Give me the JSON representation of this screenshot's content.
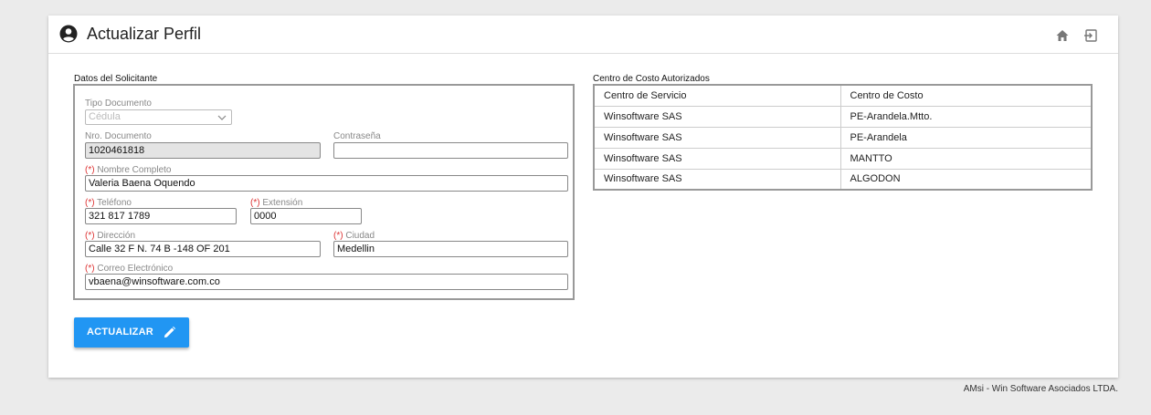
{
  "header": {
    "title": "Actualizar Perfil",
    "title_icon": "user-circle-icon",
    "home_icon": "home-icon",
    "exit_icon": "exit-icon"
  },
  "form": {
    "section_label": "Datos del Solicitante",
    "tipo_documento": {
      "label": "Tipo Documento",
      "value": "Cédula"
    },
    "nro_documento": {
      "label": "Nro. Documento",
      "value": "1020461818"
    },
    "contrasena": {
      "label": "Contraseña",
      "value": ""
    },
    "nombre": {
      "req": "(*)",
      "label": " Nombre Completo",
      "value": "Valeria Baena Oquendo"
    },
    "telefono": {
      "req": "(*)",
      "label": " Teléfono",
      "value": "321 817 1789"
    },
    "extension": {
      "req": "(*)",
      "label": " Extensión",
      "value": "0000"
    },
    "direccion": {
      "req": "(*)",
      "label": " Dirección",
      "value": "Calle 32 F N. 74 B -148 OF 201"
    },
    "ciudad": {
      "req": "(*)",
      "label": " Ciudad",
      "value": "Medellin"
    },
    "correo": {
      "req": "(*)",
      "label": " Correo Electrónico",
      "value": "vbaena@winsoftware.com.co"
    }
  },
  "costos": {
    "section_label": "Centro de Costo Autorizados",
    "headers": [
      "Centro de Servicio",
      "Centro de Costo"
    ],
    "rows": [
      [
        "Winsoftware SAS",
        "PE-Arandela.Mtto."
      ],
      [
        "Winsoftware SAS",
        "PE-Arandela"
      ],
      [
        "Winsoftware SAS",
        "MANTTO"
      ],
      [
        "Winsoftware SAS",
        "ALGODON"
      ]
    ]
  },
  "button": {
    "label": "ACTUALIZAR",
    "icon": "pencil-icon",
    "color": "#2196f3"
  },
  "footer": "AMsi - Win Software Asociados LTDA."
}
